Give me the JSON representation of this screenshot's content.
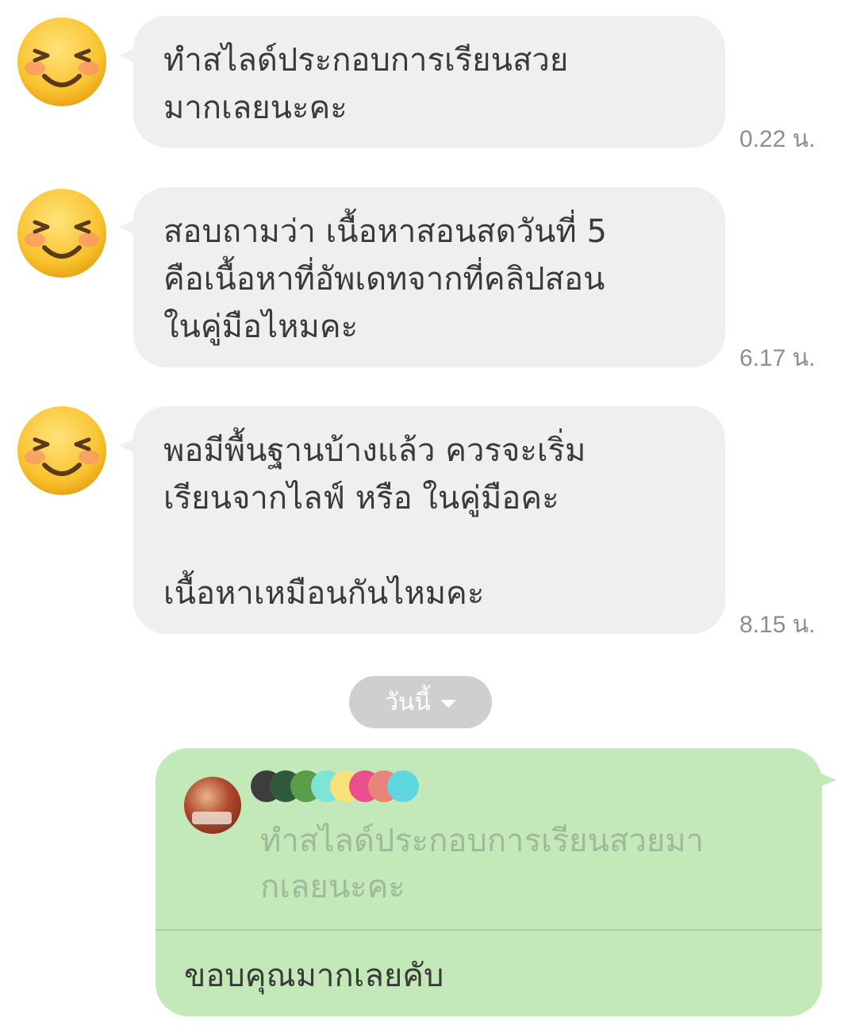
{
  "messages": [
    {
      "text": "ทำสไลด์ประกอบการเรียนสวย\nมากเลยนะคะ",
      "time": "0.22 น.",
      "avatar_icon": "smiling-face-emoji"
    },
    {
      "text": "สอบถามว่า เนื้อหาสอนสดวันที่ 5\nคือเนื้อหาที่อัพเดทจากที่คลิปสอน\nในคู่มือไหมคะ",
      "time": "6.17 น.",
      "avatar_icon": "smiling-face-emoji"
    },
    {
      "text": "พอมีพื้นฐานบ้างแล้ว ควรจะเริ่ม\nเรียนจากไลฟ์  หรือ ในคู่มือคะ\n\nเนื้อหาเหมือนกันไหมคะ",
      "time": "8.15 น.",
      "avatar_icon": "smiling-face-emoji"
    }
  ],
  "date_separator": {
    "label": "วันนี้",
    "icon": "chevron-down-icon"
  },
  "outgoing": {
    "reply_to_text": "ทำสไลด์ประกอบการเรียนสวยมา\nกเลยนะคะ",
    "text": "ขอบคุณมากเลยคับ"
  },
  "colors": {
    "incoming_bubble": "#efeff2",
    "outgoing_bubble": "#c2e9b7",
    "time_text": "#8e8e8e",
    "date_pill": "#cfcfcf"
  }
}
